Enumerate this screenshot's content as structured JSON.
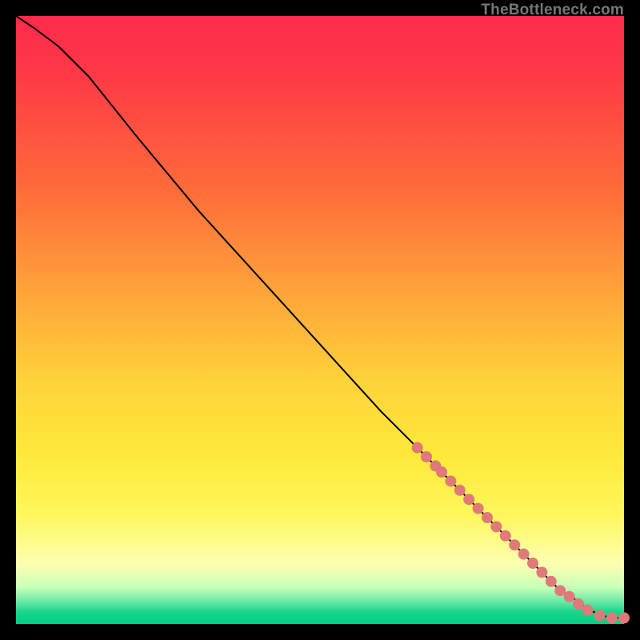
{
  "watermark": "TheBottleneck.com",
  "colors": {
    "marker": "#e07a7a",
    "curve": "#000000"
  },
  "chart_data": {
    "type": "line",
    "title": "",
    "xlabel": "",
    "ylabel": "",
    "xlim": [
      0,
      100
    ],
    "ylim": [
      0,
      100
    ],
    "grid": false,
    "legend": false,
    "series": [
      {
        "name": "curve",
        "x": [
          0,
          3,
          7,
          12,
          20,
          30,
          40,
          50,
          60,
          66,
          70,
          74,
          78,
          82,
          86,
          89,
          92,
          94,
          96,
          98,
          100
        ],
        "y": [
          100,
          98,
          95,
          90,
          80,
          68,
          57,
          46,
          35,
          29,
          25,
          21,
          17,
          13,
          9,
          6,
          4,
          2.5,
          1.5,
          1,
          1
        ]
      }
    ],
    "markers": [
      {
        "x": 66,
        "y": 29
      },
      {
        "x": 67.5,
        "y": 27.5
      },
      {
        "x": 69,
        "y": 26
      },
      {
        "x": 70,
        "y": 25
      },
      {
        "x": 71.5,
        "y": 23.5
      },
      {
        "x": 73,
        "y": 22
      },
      {
        "x": 74.5,
        "y": 20.5
      },
      {
        "x": 76,
        "y": 19
      },
      {
        "x": 77.5,
        "y": 17.5
      },
      {
        "x": 79,
        "y": 16
      },
      {
        "x": 80.5,
        "y": 14.5
      },
      {
        "x": 82,
        "y": 13
      },
      {
        "x": 83.5,
        "y": 11.5
      },
      {
        "x": 85,
        "y": 10
      },
      {
        "x": 86.5,
        "y": 8.5
      },
      {
        "x": 88,
        "y": 7
      },
      {
        "x": 89.5,
        "y": 5.5
      },
      {
        "x": 91,
        "y": 4.5
      },
      {
        "x": 92.5,
        "y": 3.3
      },
      {
        "x": 94,
        "y": 2.3
      },
      {
        "x": 96,
        "y": 1.4
      },
      {
        "x": 98,
        "y": 1
      },
      {
        "x": 100,
        "y": 1
      }
    ],
    "marker_radius": 7
  }
}
